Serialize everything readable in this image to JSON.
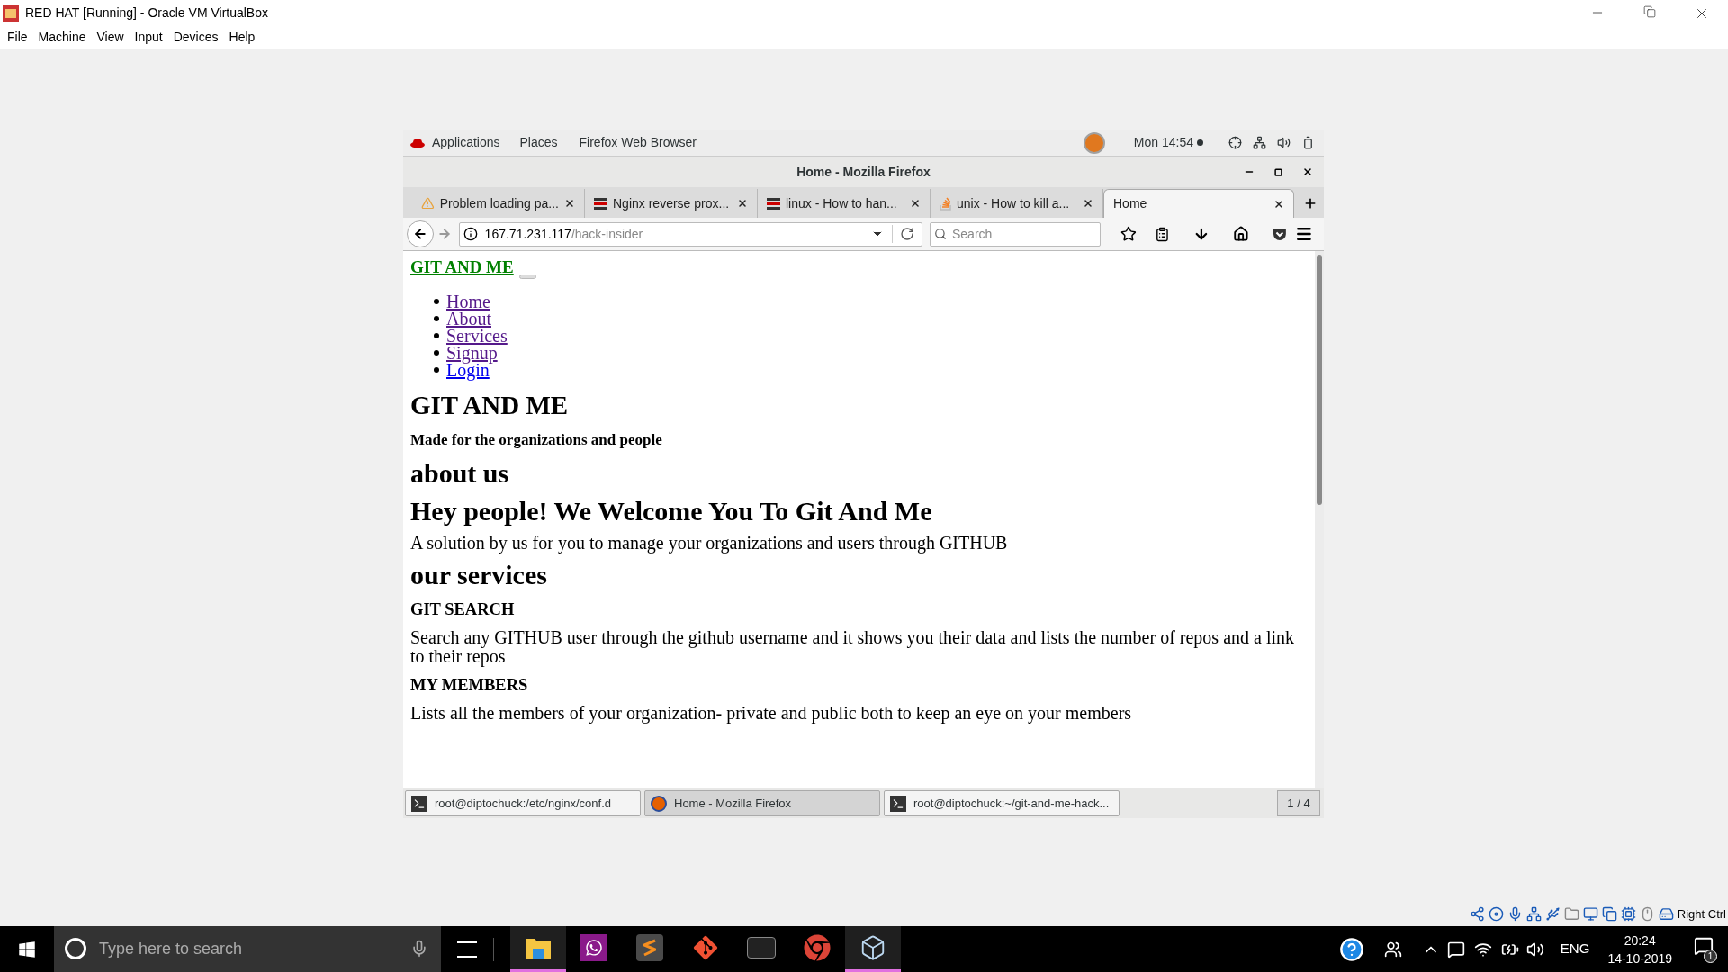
{
  "window": {
    "title": "RED HAT [Running] - Oracle VM VirtualBox"
  },
  "menu": [
    "File",
    "Machine",
    "View",
    "Input",
    "Devices",
    "Help"
  ],
  "gnome_bar": {
    "items": [
      "Applications",
      "Places",
      "Firefox Web Browser"
    ],
    "clock": "Mon 14:54"
  },
  "firefox": {
    "title": "Home - Mozilla Firefox",
    "tabs": [
      {
        "label": "Problem loading pa...",
        "kind": "warning",
        "selected": false
      },
      {
        "label": "Nginx reverse prox...",
        "kind": "bars",
        "selected": false
      },
      {
        "label": "linux - How to han...",
        "kind": "bars",
        "selected": false
      },
      {
        "label": "unix - How to kill a...",
        "kind": "stack",
        "selected": false
      },
      {
        "label": "Home",
        "kind": "none",
        "selected": true
      }
    ],
    "url": {
      "host": "167.71.231.117",
      "path": "/hack-insider"
    },
    "search": {
      "placeholder": "Search"
    }
  },
  "page": {
    "brand": "GIT AND ME",
    "nav": [
      {
        "label": "Home",
        "visited": true
      },
      {
        "label": "About",
        "visited": true
      },
      {
        "label": "Services",
        "visited": true
      },
      {
        "label": "Signup",
        "visited": true
      },
      {
        "label": "Login",
        "visited": false
      }
    ],
    "content": [
      {
        "kind": "h1",
        "text": "GIT AND ME"
      },
      {
        "kind": "h5",
        "text": "Made for the organizations and people"
      },
      {
        "kind": "h2",
        "text": "about us"
      },
      {
        "kind": "h2",
        "text": "Hey people! We Welcome You To Git And Me"
      },
      {
        "kind": "p",
        "text": "A solution by us for you to manage your organizations and users through GITHUB"
      },
      {
        "kind": "h2",
        "text": "our services"
      },
      {
        "kind": "h4",
        "text": "GIT SEARCH"
      },
      {
        "kind": "p",
        "text": "Search any GITHUB user through the github username and it shows you their data and lists the number of repos and a link to their repos"
      },
      {
        "kind": "h4",
        "text": "MY MEMBERS"
      },
      {
        "kind": "p",
        "text": "Lists all the members of your organization- private and public both to keep an eye on your members"
      }
    ]
  },
  "window_list": {
    "items": [
      {
        "label": "root@diptochuck:/etc/nginx/conf.d",
        "kind": "terminal",
        "selected": false
      },
      {
        "label": "Home - Mozilla Firefox",
        "kind": "browser",
        "selected": true
      },
      {
        "label": "root@diptochuck:~/git-and-me-hack...",
        "kind": "terminal",
        "selected": false
      }
    ],
    "workspace": "1 / 4"
  },
  "host_key": "Right Ctrl",
  "taskbar": {
    "search": {
      "placeholder": "Type here to search"
    },
    "apps": [
      {
        "kind": "folder",
        "active": true
      },
      {
        "kind": "chat",
        "active": false
      },
      {
        "kind": "editor",
        "active": false
      },
      {
        "kind": "git",
        "active": false
      },
      {
        "kind": "terminal",
        "active": false
      },
      {
        "kind": "browser",
        "active": false
      },
      {
        "kind": "cube",
        "active": true
      }
    ],
    "language": "ENG",
    "time": "20:24",
    "date": "14-10-2019",
    "notifications": "1"
  }
}
